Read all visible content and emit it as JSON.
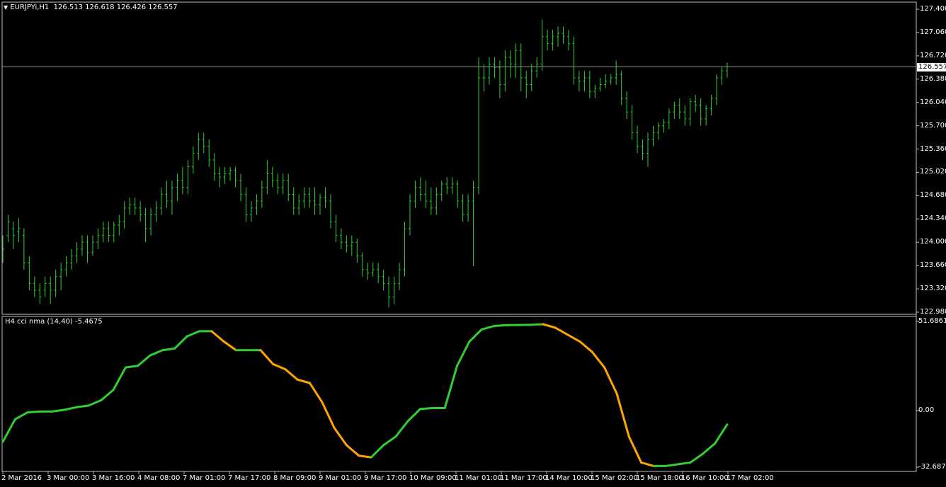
{
  "main_panel": {
    "symbol_header": "EURJPYi,H1",
    "ohlc_header": "126.513 126.618 126.426 126.557",
    "current_price": "126.557"
  },
  "indicator_panel": {
    "header": "H4 cci nma (14,40) -5.4675",
    "scale_labels": [
      "51.6861",
      "0.00",
      "-32.687"
    ]
  },
  "chart_data": [
    {
      "type": "ohlc",
      "title": "EURJPYi,H1",
      "ylim": [
        122.98,
        127.4
      ],
      "y_ticks": [
        "127.400",
        "127.060",
        "126.720",
        "126.380",
        "126.040",
        "125.700",
        "125.360",
        "125.020",
        "124.680",
        "124.340",
        "124.000",
        "123.660",
        "123.320",
        "122.980"
      ],
      "horizontal_line": 126.557,
      "color": "#32cd32",
      "points": [
        [
          124.05,
          124.1,
          123.7,
          123.9
        ],
        [
          124.1,
          124.4,
          124.0,
          124.3
        ],
        [
          124.2,
          124.3,
          123.9,
          124.1
        ],
        [
          124.15,
          124.35,
          124.0,
          124.2
        ],
        [
          124.1,
          124.2,
          123.6,
          123.7
        ],
        [
          123.7,
          123.8,
          123.3,
          123.4
        ],
        [
          123.4,
          123.5,
          123.2,
          123.3
        ],
        [
          123.3,
          123.4,
          123.1,
          123.2
        ],
        [
          123.3,
          123.5,
          123.2,
          123.4
        ],
        [
          123.4,
          123.5,
          123.1,
          123.3
        ],
        [
          123.3,
          123.6,
          123.2,
          123.5
        ],
        [
          123.5,
          123.7,
          123.3,
          123.6
        ],
        [
          123.6,
          123.8,
          123.5,
          123.7
        ],
        [
          123.7,
          123.9,
          123.6,
          123.8
        ],
        [
          123.8,
          124.0,
          123.7,
          123.9
        ],
        [
          123.9,
          124.1,
          123.8,
          124.0
        ],
        [
          124.0,
          124.1,
          123.7,
          123.85
        ],
        [
          123.85,
          124.1,
          123.8,
          124.0
        ],
        [
          124.0,
          124.2,
          123.9,
          124.1
        ],
        [
          124.1,
          124.3,
          124.0,
          124.2
        ],
        [
          124.2,
          124.3,
          124.0,
          124.1
        ],
        [
          124.1,
          124.3,
          124.0,
          124.25
        ],
        [
          124.25,
          124.4,
          124.1,
          124.3
        ],
        [
          124.3,
          124.6,
          124.2,
          124.5
        ],
        [
          124.5,
          124.65,
          124.4,
          124.55
        ],
        [
          124.55,
          124.65,
          124.4,
          124.5
        ],
        [
          124.5,
          124.6,
          124.3,
          124.4
        ],
        [
          124.4,
          124.5,
          124.0,
          124.2
        ],
        [
          124.2,
          124.5,
          124.1,
          124.4
        ],
        [
          124.4,
          124.6,
          124.3,
          124.5
        ],
        [
          124.5,
          124.8,
          124.4,
          124.7
        ],
        [
          124.7,
          124.9,
          124.5,
          124.6
        ],
        [
          124.6,
          124.9,
          124.4,
          124.8
        ],
        [
          124.8,
          125.0,
          124.6,
          124.9
        ],
        [
          124.9,
          125.1,
          124.7,
          124.8
        ],
        [
          124.8,
          125.2,
          124.7,
          125.1
        ],
        [
          125.1,
          125.4,
          125.0,
          125.3
        ],
        [
          125.3,
          125.6,
          125.2,
          125.5
        ],
        [
          125.5,
          125.6,
          125.3,
          125.4
        ],
        [
          125.4,
          125.5,
          125.1,
          125.2
        ],
        [
          125.2,
          125.3,
          124.9,
          125.0
        ],
        [
          125.0,
          125.1,
          124.8,
          124.95
        ],
        [
          124.95,
          125.1,
          124.85,
          125.0
        ],
        [
          125.0,
          125.1,
          124.9,
          125.05
        ],
        [
          125.05,
          125.1,
          124.8,
          124.9
        ],
        [
          124.9,
          125.0,
          124.6,
          124.7
        ],
        [
          124.7,
          124.8,
          124.3,
          124.4
        ],
        [
          124.4,
          124.6,
          124.3,
          124.5
        ],
        [
          124.5,
          124.7,
          124.4,
          124.6
        ],
        [
          124.6,
          124.9,
          124.5,
          124.8
        ],
        [
          124.8,
          125.2,
          124.7,
          125.0
        ],
        [
          125.0,
          125.1,
          124.8,
          124.9
        ],
        [
          124.9,
          125.0,
          124.7,
          124.8
        ],
        [
          124.8,
          125.0,
          124.7,
          124.9
        ],
        [
          124.9,
          125.0,
          124.6,
          124.7
        ],
        [
          124.7,
          124.8,
          124.4,
          124.5
        ],
        [
          124.5,
          124.7,
          124.4,
          124.6
        ],
        [
          124.6,
          124.8,
          124.5,
          124.7
        ],
        [
          124.7,
          124.8,
          124.5,
          124.6
        ],
        [
          124.6,
          124.8,
          124.4,
          124.55
        ],
        [
          124.55,
          124.7,
          124.4,
          124.65
        ],
        [
          124.65,
          124.8,
          124.5,
          124.6
        ],
        [
          124.6,
          124.7,
          124.2,
          124.3
        ],
        [
          124.3,
          124.4,
          124.0,
          124.1
        ],
        [
          124.1,
          124.2,
          123.9,
          124.0
        ],
        [
          124.0,
          124.1,
          123.85,
          123.95
        ],
        [
          123.95,
          124.1,
          123.8,
          124.0
        ],
        [
          124.0,
          124.05,
          123.7,
          123.8
        ],
        [
          123.8,
          123.85,
          123.5,
          123.6
        ],
        [
          123.6,
          123.7,
          123.45,
          123.55
        ],
        [
          123.55,
          123.7,
          123.5,
          123.6
        ],
        [
          123.6,
          123.7,
          123.4,
          123.5
        ],
        [
          123.5,
          123.6,
          123.3,
          123.4
        ],
        [
          123.4,
          123.5,
          123.05,
          123.2
        ],
        [
          123.2,
          123.5,
          123.1,
          123.4
        ],
        [
          123.4,
          123.7,
          123.3,
          123.6
        ],
        [
          123.6,
          124.3,
          123.5,
          124.2
        ],
        [
          124.2,
          124.7,
          124.1,
          124.6
        ],
        [
          124.6,
          124.9,
          124.5,
          124.8
        ],
        [
          124.8,
          124.95,
          124.6,
          124.7
        ],
        [
          124.7,
          124.9,
          124.5,
          124.6
        ],
        [
          124.6,
          124.8,
          124.4,
          124.5
        ],
        [
          124.5,
          124.8,
          124.4,
          124.7
        ],
        [
          124.7,
          124.9,
          124.6,
          124.85
        ],
        [
          124.85,
          124.95,
          124.7,
          124.8
        ],
        [
          124.8,
          124.95,
          124.7,
          124.85
        ],
        [
          124.85,
          124.9,
          124.5,
          124.6
        ],
        [
          124.6,
          124.7,
          124.3,
          124.4
        ],
        [
          124.4,
          124.7,
          124.3,
          124.6
        ],
        [
          124.6,
          124.9,
          123.65,
          124.8
        ],
        [
          124.8,
          126.7,
          124.7,
          126.4
        ],
        [
          126.4,
          126.6,
          126.2,
          126.4
        ],
        [
          126.4,
          126.7,
          126.3,
          126.6
        ],
        [
          126.6,
          126.7,
          126.4,
          126.55
        ],
        [
          126.55,
          126.65,
          126.1,
          126.3
        ],
        [
          126.3,
          126.8,
          126.2,
          126.7
        ],
        [
          126.7,
          126.8,
          126.4,
          126.6
        ],
        [
          126.6,
          126.9,
          126.4,
          126.8
        ],
        [
          126.8,
          126.9,
          126.2,
          126.4
        ],
        [
          126.4,
          126.5,
          126.1,
          126.3
        ],
        [
          126.3,
          126.6,
          126.2,
          126.5
        ],
        [
          126.5,
          126.7,
          126.4,
          126.6
        ],
        [
          126.6,
          127.25,
          126.5,
          127.0
        ],
        [
          127.0,
          127.1,
          126.8,
          126.9
        ],
        [
          126.9,
          127.1,
          126.8,
          127.0
        ],
        [
          127.0,
          127.15,
          126.85,
          127.05
        ],
        [
          127.05,
          127.15,
          126.9,
          127.0
        ],
        [
          127.0,
          127.1,
          126.8,
          126.9
        ],
        [
          126.9,
          127.0,
          126.3,
          126.4
        ],
        [
          126.4,
          126.5,
          126.2,
          126.35
        ],
        [
          126.35,
          126.5,
          126.2,
          126.4
        ],
        [
          126.4,
          126.5,
          126.1,
          126.2
        ],
        [
          126.2,
          126.3,
          126.1,
          126.25
        ],
        [
          126.25,
          126.4,
          126.2,
          126.3
        ],
        [
          126.3,
          126.45,
          126.25,
          126.35
        ],
        [
          126.35,
          126.45,
          126.3,
          126.4
        ],
        [
          126.4,
          126.65,
          126.3,
          126.45
        ],
        [
          126.45,
          126.5,
          126.0,
          126.1
        ],
        [
          126.1,
          126.2,
          125.8,
          125.9
        ],
        [
          125.9,
          126.0,
          125.5,
          125.6
        ],
        [
          125.6,
          125.7,
          125.3,
          125.4
        ],
        [
          125.4,
          125.5,
          125.2,
          125.3
        ],
        [
          125.3,
          125.6,
          125.1,
          125.5
        ],
        [
          125.5,
          125.7,
          125.4,
          125.6
        ],
        [
          125.6,
          125.75,
          125.5,
          125.7
        ],
        [
          125.7,
          125.8,
          125.6,
          125.75
        ],
        [
          125.75,
          125.95,
          125.65,
          125.9
        ],
        [
          125.9,
          126.05,
          125.8,
          126.0
        ],
        [
          126.0,
          126.1,
          125.8,
          125.9
        ],
        [
          125.9,
          126.0,
          125.7,
          125.8
        ],
        [
          125.8,
          126.1,
          125.7,
          126.05
        ],
        [
          126.05,
          126.15,
          125.9,
          126.0
        ],
        [
          126.0,
          126.1,
          125.7,
          125.8
        ],
        [
          125.8,
          126.0,
          125.7,
          125.95
        ],
        [
          125.95,
          126.15,
          125.85,
          126.1
        ],
        [
          126.1,
          126.45,
          126.0,
          126.4
        ],
        [
          126.4,
          126.55,
          126.3,
          126.5
        ],
        [
          126.5,
          126.62,
          126.4,
          126.56
        ]
      ]
    },
    {
      "type": "line",
      "title": "H4 cci nma (14,40) -5.4675",
      "ylim": [
        -32.687,
        51.6861
      ],
      "y_ticks": [
        "51.6861",
        "0.00",
        "-32.687"
      ],
      "colors": {
        "rising": "#32cd32",
        "falling": "#ffa500"
      },
      "x_tick_labels": [
        "2 Mar 2016",
        "3 Mar 00:00",
        "3 Mar 16:00",
        "4 Mar 08:00",
        "7 Mar 01:00",
        "7 Mar 17:00",
        "8 Mar 09:00",
        "9 Mar 01:00",
        "9 Mar 17:00",
        "10 Mar 09:00",
        "11 Mar 01:00",
        "11 Mar 17:00",
        "14 Mar 10:00",
        "15 Mar 02:00",
        "15 Mar 18:00",
        "16 Mar 10:00",
        "17 Mar 02:00"
      ],
      "series": [
        {
          "values": [
            -18,
            -5,
            -1,
            -0.5,
            -0.5,
            0.5,
            2,
            3,
            6,
            12,
            25,
            26,
            32,
            35,
            36,
            43,
            46,
            46,
            40,
            35,
            35,
            35,
            27,
            24,
            18,
            16,
            5,
            -10,
            -20,
            -26,
            -27,
            -20,
            -15,
            -6,
            1,
            1.5,
            1.5,
            26,
            40,
            47,
            49,
            49.5,
            49.6,
            49.7,
            50,
            48,
            44,
            40,
            34,
            25,
            10,
            -15,
            -30,
            -32,
            -32,
            -31,
            -30,
            -25,
            -19,
            -8
          ]
        }
      ]
    }
  ]
}
